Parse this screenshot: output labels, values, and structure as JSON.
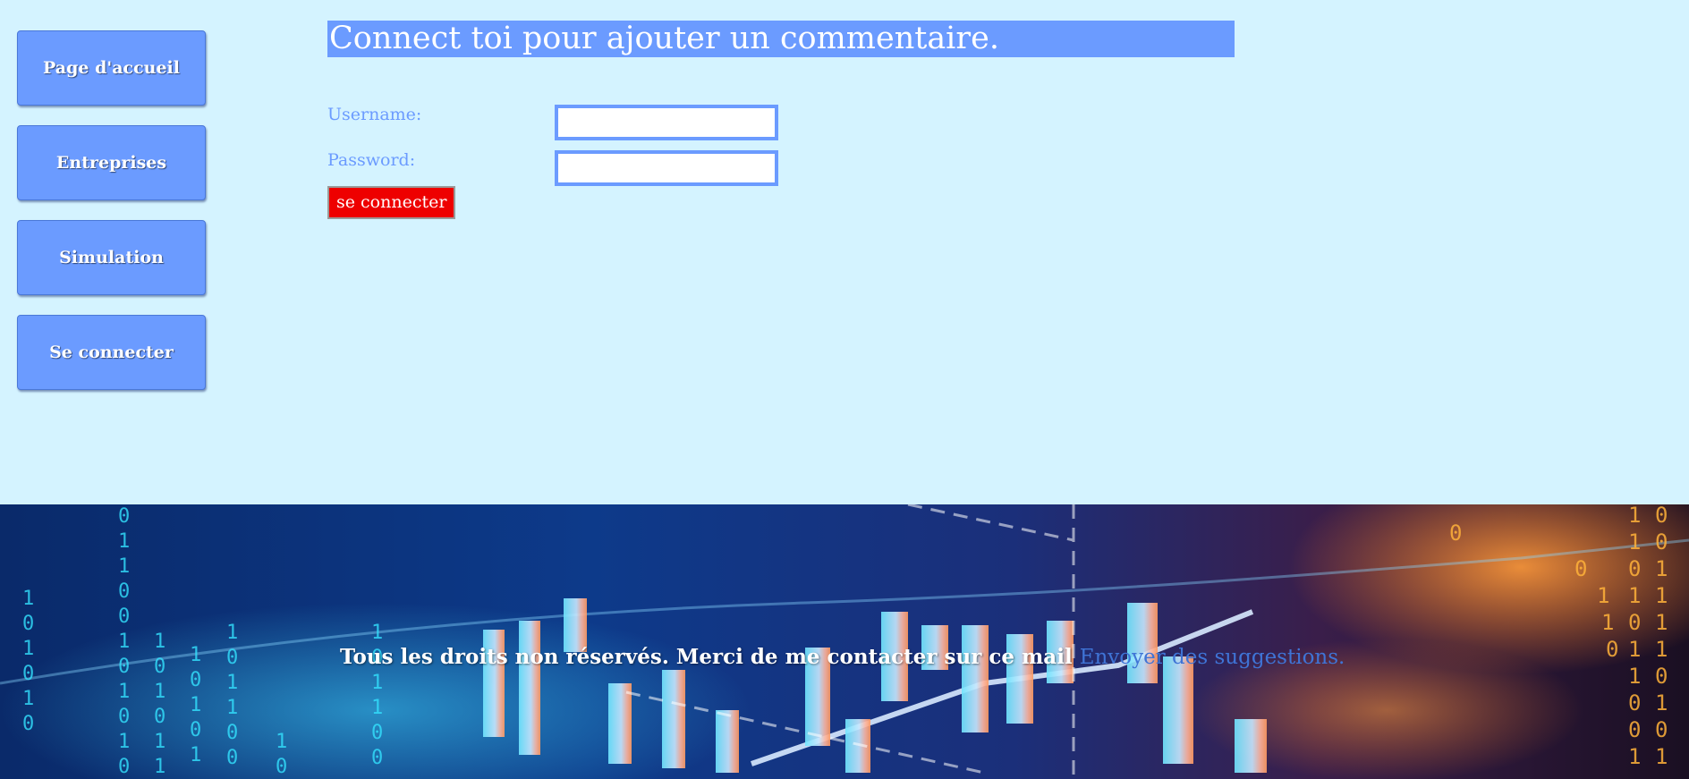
{
  "sidebar": {
    "items": [
      {
        "label": "Page d'accueil"
      },
      {
        "label": "Entreprises"
      },
      {
        "label": "Simulation"
      },
      {
        "label": "Se connecter"
      }
    ]
  },
  "form": {
    "title": "Connect toi pour ajouter un commentaire.",
    "username_label": "Username:",
    "username_value": "",
    "password_label": "Password:",
    "password_value": "",
    "submit_label": "se connecter"
  },
  "footer": {
    "text": "Tous les droits non réservés. Merci de me contacter sur ce mail",
    "link_label": "Envoyer des suggestions."
  },
  "colors": {
    "background": "#d4f3ff",
    "accent": "#6b9bff",
    "submit": "#ee0000",
    "link": "#3f74d6"
  }
}
